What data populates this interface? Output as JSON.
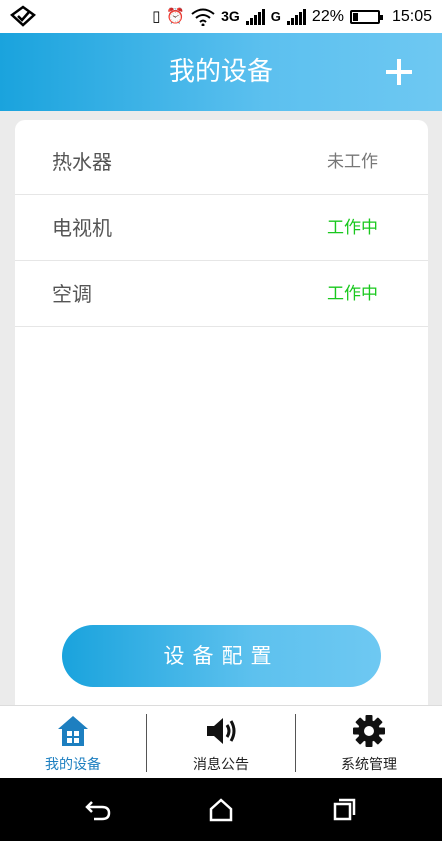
{
  "status_bar": {
    "network_type": "3G",
    "network_badge": "G",
    "battery_percent_label": "22%",
    "battery_level": 0.22,
    "time": "15:05"
  },
  "header": {
    "title": "我的设备",
    "add_icon": "plus-icon"
  },
  "devices": [
    {
      "name": "热水器",
      "status": "未工作",
      "active": false
    },
    {
      "name": "电视机",
      "status": "工作中",
      "active": true
    },
    {
      "name": "空调",
      "status": "工作中",
      "active": true
    }
  ],
  "config_button_label": "设备配置",
  "bottom_nav": {
    "items": [
      {
        "label": "我的设备",
        "icon": "home-icon",
        "active": true
      },
      {
        "label": "消息公告",
        "icon": "speaker-icon",
        "active": false
      },
      {
        "label": "系统管理",
        "icon": "gear-icon",
        "active": false
      }
    ]
  },
  "colors": {
    "accent": "#1aa3dd",
    "accent_light": "#6ec8f2",
    "active_status": "#19c81e",
    "inactive_status": "#777777",
    "nav_active": "#1d7fc0"
  },
  "system_nav": {
    "icons": [
      "back-icon",
      "home-nav-icon",
      "recents-icon"
    ]
  }
}
